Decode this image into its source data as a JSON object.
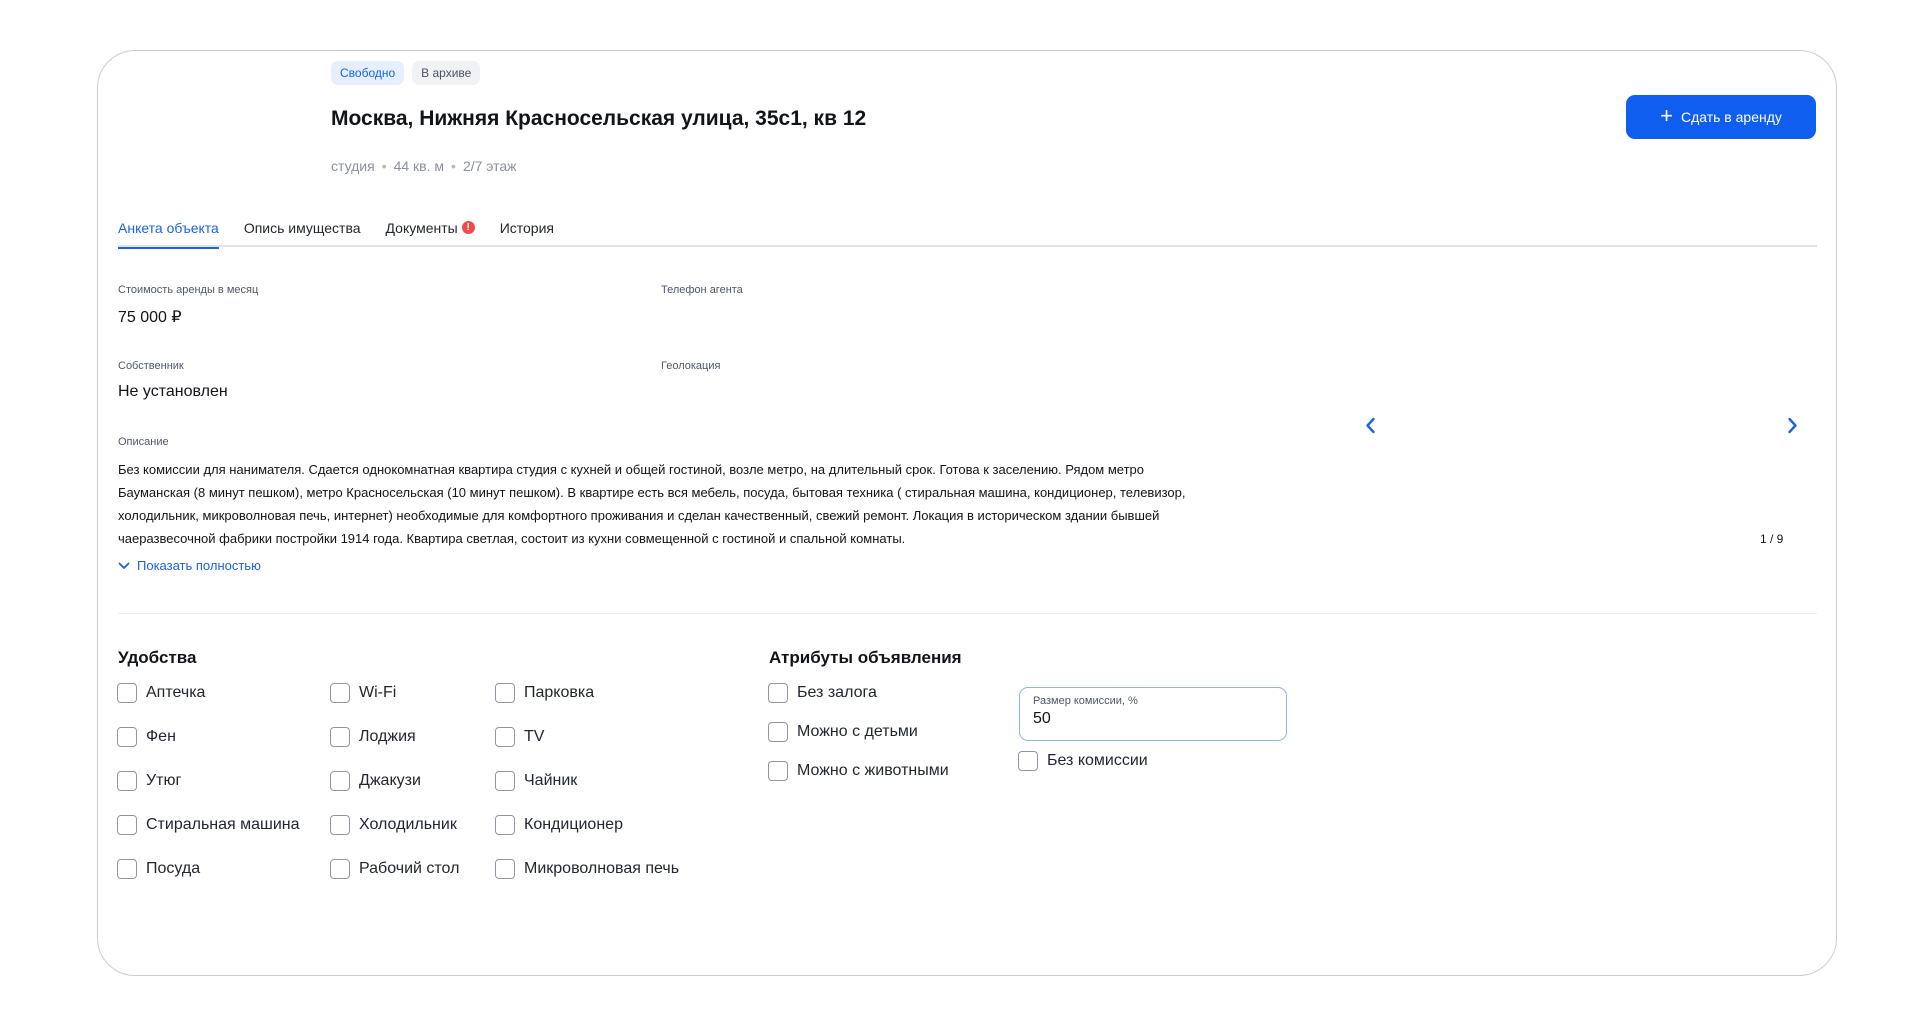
{
  "header": {
    "badges": [
      {
        "label": "Свободно"
      },
      {
        "label": "В архиве"
      }
    ],
    "title": "Москва, Нижняя Красносельская улица, 35с1, кв 12",
    "meta": {
      "type": "студия",
      "area": "44 кв. м",
      "floor": "2/7 этаж"
    },
    "rent_button_label": "Сдать в аренду"
  },
  "tabs": [
    {
      "label": "Анкета объекта",
      "active": true
    },
    {
      "label": "Опись имущества",
      "active": false
    },
    {
      "label": "Документы",
      "active": false,
      "alert": "!"
    },
    {
      "label": "История",
      "active": false
    }
  ],
  "fields": {
    "rent_price": {
      "label": "Стоимость аренды в месяц",
      "value": "75 000 ₽"
    },
    "agent_phone": {
      "label": "Телефон агента",
      "value": ""
    },
    "owner": {
      "label": "Собственник",
      "value": "Не установлен"
    },
    "geolocation": {
      "label": "Геолокация",
      "value": ""
    },
    "description": {
      "label": "Описание",
      "text": "Без комиссии для нанимателя. Сдается однокомнатная квартира студия с кухней и общей гостиной, возле метро, на длительный срок. Готова к заселению. Рядом метро Бауманская (8 минут пешком), метро Красносельская (10 минут пешком). В квартире есть вся мебель, посуда, бытовая техника ( стиральная машина, кондиционер, телевизор, холодильник, микроволновая печь, интернет) необходимые для комфортного проживания и сделан качественный, свежий ремонт. Локация в историческом здании бывшей чаеразвесочной фабрики постройки 1914 года. Квартира светлая, состоит из кухни совмещенной с гостиной и спальной комнаты.",
      "show_more": "Показать полностью"
    }
  },
  "gallery": {
    "counter": "1 / 9",
    "current": 1,
    "total": 9
  },
  "amenities": {
    "title": "Удобства",
    "columns": [
      [
        "Аптечка",
        "Фен",
        "Утюг",
        "Стиральная машина",
        "Посуда"
      ],
      [
        "Wi-Fi",
        "Лоджия",
        "Джакузи",
        "Холодильник",
        "Рабочий стол"
      ],
      [
        "Парковка",
        "TV",
        "Чайник",
        "Кондиционер",
        "Микроволновая печь"
      ]
    ]
  },
  "listing_attributes": {
    "title": "Атрибуты объявления",
    "items": [
      "Без залога",
      "Можно с детьми",
      "Можно с животными"
    ],
    "commission": {
      "label": "Размер комиссии, %",
      "value": "50",
      "no_commission_label": "Без комиссии"
    }
  },
  "colors": {
    "accent": "#0f5ef0",
    "alert": "#ee4b4b",
    "badge_free_bg": "#e6efff"
  }
}
